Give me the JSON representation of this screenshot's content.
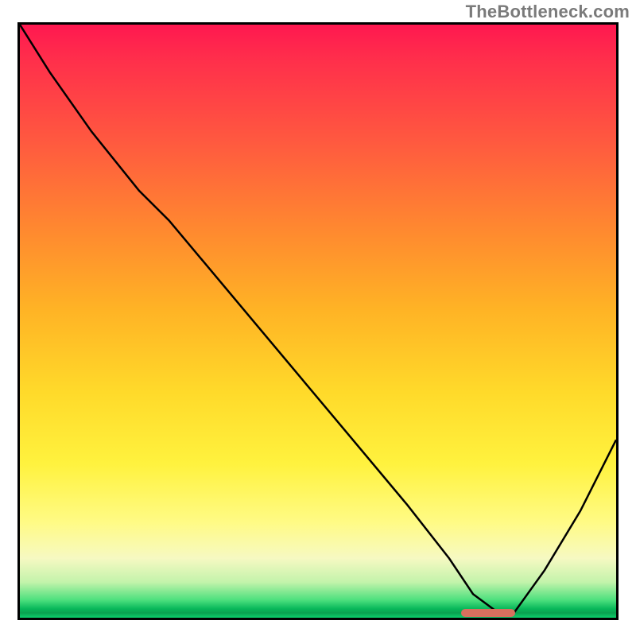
{
  "watermark": "TheBottleneck.com",
  "chart_data": {
    "type": "line",
    "title": "",
    "xlabel": "",
    "ylabel": "",
    "xlim": [
      0,
      100
    ],
    "ylim": [
      0,
      100
    ],
    "grid": false,
    "legend": false,
    "background": {
      "type": "vertical-gradient",
      "stops": [
        {
          "pos": 0,
          "color": "#ff1850"
        },
        {
          "pos": 0.2,
          "color": "#ff5a3f"
        },
        {
          "pos": 0.48,
          "color": "#ffb325"
        },
        {
          "pos": 0.74,
          "color": "#fff23e"
        },
        {
          "pos": 0.9,
          "color": "#f6f9c2"
        },
        {
          "pos": 0.97,
          "color": "#4de07e"
        },
        {
          "pos": 1.0,
          "color": "#0ccf6c"
        }
      ]
    },
    "series": [
      {
        "name": "bottleneck-curve",
        "color": "#000000",
        "x": [
          0,
          5,
          12,
          20,
          25,
          35,
          45,
          55,
          65,
          72,
          76,
          80,
          83,
          88,
          94,
          100
        ],
        "y": [
          100,
          92,
          82,
          72,
          67,
          55,
          43,
          31,
          19,
          10,
          4,
          1,
          1,
          8,
          18,
          30
        ]
      }
    ],
    "marker": {
      "name": "optimal-range",
      "color": "#d7705e",
      "x_start": 74,
      "x_end": 83,
      "y": 0.8
    }
  }
}
